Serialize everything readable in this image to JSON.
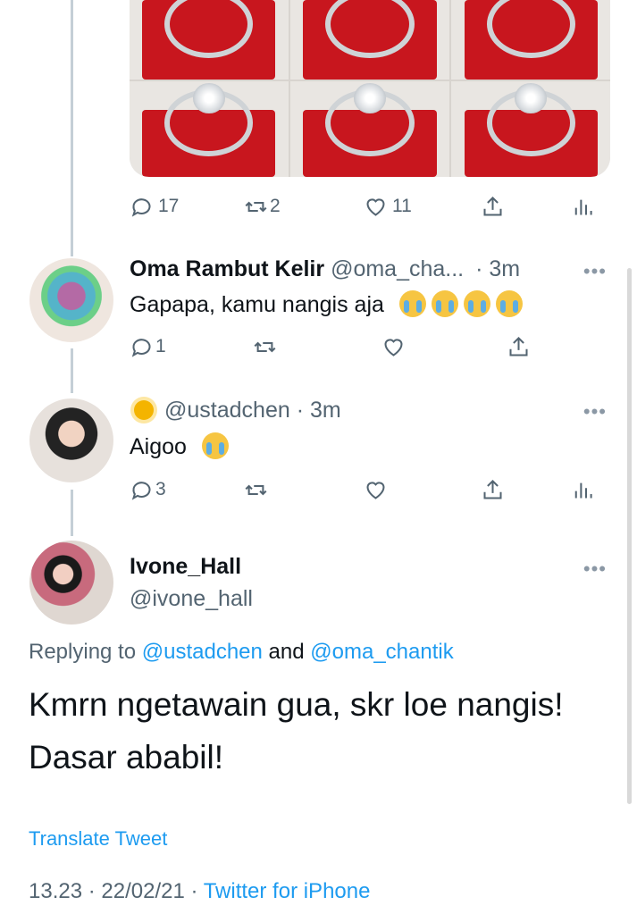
{
  "top_tweet": {
    "reply_count": "17",
    "retweet_count": "2",
    "like_count": "11"
  },
  "reply1": {
    "display_name": "Oma Rambut Kelir",
    "handle": "@oma_cha...",
    "time": "· 3m",
    "text": "Gapapa, kamu nangis aja",
    "reply_count": "1",
    "emoji_count": 4
  },
  "reply2": {
    "handle": "@ustadchen",
    "time": "· 3m",
    "text": "Aigoo",
    "reply_count": "3",
    "name_emoji": "sun"
  },
  "main_tweet": {
    "display_name": "Ivone_Hall",
    "handle": "@ivone_hall",
    "replying_prefix": "Replying to",
    "replying_user1": "@ustadchen",
    "replying_and": "and",
    "replying_user2": "@oma_chantik",
    "text_line1": "Kmrn ngetawain gua, skr loe nangis!",
    "text_line2": "Dasar ababil!",
    "translate": "Translate Tweet",
    "timestamp": "13.23 · 22/02/21 ·",
    "source": "Twitter for iPhone"
  },
  "more_glyph": "•••",
  "colors": {
    "link": "#1d9bf0",
    "muted": "#536471",
    "thread_line": "#c4cfd6"
  }
}
